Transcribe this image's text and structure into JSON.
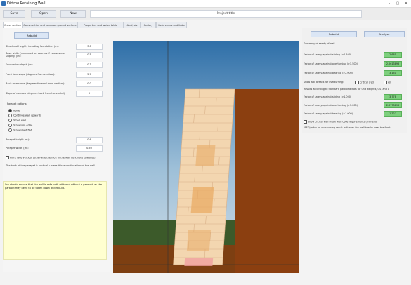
{
  "window": {
    "title": "Dirtmo Retaining Wall",
    "minimize": "–",
    "maximize": "▢",
    "close": "✕"
  },
  "toolbar": {
    "save": "Save",
    "open": "Open",
    "new": "New",
    "project_title": "Project title"
  },
  "tabs": [
    "Cross section",
    "Construction and loads on ground surface",
    "Properties and water table",
    "Analysis",
    "Gallery",
    "References and links"
  ],
  "left": {
    "rebuild": "Rebuild",
    "fields": [
      {
        "label": "Structural height, including foundation (m):",
        "value": "3.0"
      },
      {
        "label": "Base width (measured on courses if courses are sloping) (m):",
        "value": "0.5"
      },
      {
        "label": "Foundation depth (m):",
        "value": "0.3"
      },
      {
        "label": "Front face slope (degrees from vertical):",
        "value": "5.7"
      },
      {
        "label": "Back face slope (degrees forward from vertical):",
        "value": "0.0"
      },
      {
        "label": "Slope of courses (degrees back from horizontal):",
        "value": "0"
      }
    ],
    "parapet_heading": "Parapet options:",
    "parapet_options": [
      "None",
      "Continue wall upwards",
      "Small wall",
      "Stones on edge",
      "Stones laid flat"
    ],
    "parapet_height_label": "Parapet height (m):",
    "parapet_height": "0.6",
    "parapet_width_label": "Parapet width (m):",
    "parapet_width": "0.50",
    "front_face_label": "Front face vertical (otherwise the face of the wall continues upwards)",
    "back_note": "The back of the parapet is vertical, unless it is a continuation of the wall.",
    "note": "You should ensure that the wall is safe both with and without a parapet, as the parapet may need to be taken down and rebuilt."
  },
  "right": {
    "rebuild": "Rebuild",
    "analyse": "Analyse",
    "summary_title": "Summary of safety of wall",
    "rows1": [
      {
        "label": "Factor of safety against sliding (>1.500)",
        "value": "2.665"
      },
      {
        "label": "Factor of safety against overturning (>1.500)",
        "value": "2.2613893"
      },
      {
        "label": "Factor of safety against bearing (>2.000)",
        "value": "3.151"
      }
    ],
    "show_breaks_label": "Show wall breaks for overturning:",
    "critical_label": "Critical (red)",
    "all_label": "All",
    "results_note": "Results according to Standard partial factors for unit weights, OS, and L",
    "rows2": [
      {
        "label": "Factor of safety against sliding (>1.000)",
        "value": "3.778"
      },
      {
        "label": "Factor of safety against overturning (>1.000)",
        "value": "2.0773893"
      },
      {
        "label": "Factor of safety against bearing (>1.000)",
        "value": "1.727"
      }
    ],
    "show_critical_label": "Show critical wall break with code requirements (trial-end)",
    "red_note": "(RED) after an overturning result indicates the wall breaks near the front"
  }
}
